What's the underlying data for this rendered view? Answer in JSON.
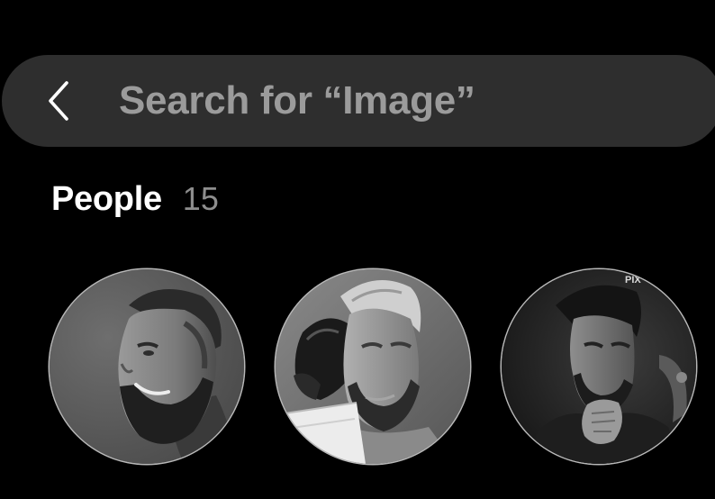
{
  "search": {
    "back_icon": "chevron-left-icon",
    "text": "Search for “Image”"
  },
  "people_section": {
    "title": "People",
    "count": "15"
  },
  "people": [
    {
      "name": "person-thumbnail-1"
    },
    {
      "name": "person-thumbnail-2"
    },
    {
      "name": "person-thumbnail-3",
      "watermark": "PIX"
    }
  ],
  "colors": {
    "background": "#000000",
    "search_bar": "#2e2e2e",
    "search_text": "#9b9b9b",
    "title": "#ffffff",
    "count": "#8e8e8e"
  }
}
